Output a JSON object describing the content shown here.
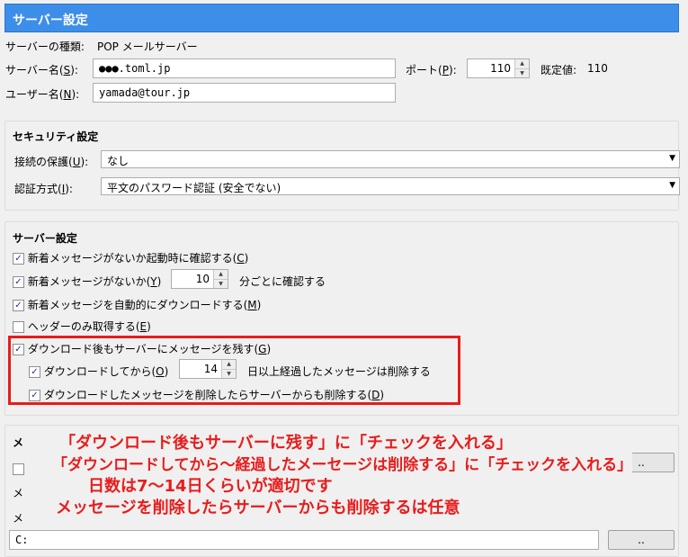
{
  "header": {
    "title": "サーバー設定"
  },
  "server": {
    "type_label": "サーバーの種類:",
    "type_value": "POP メールサーバー",
    "name_label_pre": "サーバー名(",
    "name_label_key": "S",
    "name_label_post": "):",
    "name_value": "●●●.toml.jp",
    "port_label_pre": "ポート(",
    "port_label_key": "P",
    "port_label_post": "):",
    "port_value": "110",
    "default_label": "既定値:",
    "default_value": "110",
    "user_label_pre": "ユーザー名(",
    "user_label_key": "N",
    "user_label_post": "):",
    "user_value": "yamada@tour.jp"
  },
  "security": {
    "title": "セキュリティ設定",
    "conn_label_pre": "接続の保護(",
    "conn_label_key": "U",
    "conn_label_post": "):",
    "conn_value": "なし",
    "auth_label_pre": "認証方式(",
    "auth_label_key": "I",
    "auth_label_post": "):",
    "auth_value": "平文のパスワード認証 (安全でない)"
  },
  "settings": {
    "title": "サーバー設定",
    "items": [
      {
        "pre": "新着メッセージがないか起動時に確認する(",
        "key": "C",
        "post": ")",
        "checked": true
      },
      {
        "pre": "新着メッセージがないか(",
        "key": "Y",
        "post": ")",
        "checked": true,
        "spin": "10",
        "suffix": "分ごとに確認する"
      },
      {
        "pre": "新着メッセージを自動的にダウンロードする(",
        "key": "M",
        "post": ")",
        "checked": true
      },
      {
        "pre": "ヘッダーのみ取得する(",
        "key": "E",
        "post": ")",
        "checked": false
      },
      {
        "pre": "ダウンロード後もサーバーにメッセージを残す(",
        "key": "G",
        "post": ")",
        "checked": true
      },
      {
        "pre": "ダウンロードしてから(",
        "key": "O",
        "post": ")",
        "checked": true,
        "spin": "14",
        "suffix": "日以上経過したメッセージは削除する"
      },
      {
        "pre": "ダウンロードしたメッセージを削除したらサーバーからも削除する(",
        "key": "D",
        "post": ")",
        "checked": true
      }
    ]
  },
  "annotation": {
    "lines": [
      "「ダウンロード後もサーバーに残す」に「チェックを入れる」",
      "「ダウンロードしてから〜経過したメーセージは削除する」に「チェックを入れる」",
      "日数は7〜14日くらいが適切です",
      "メッセージを削除したらサーバーからも削除するは任意"
    ],
    "color": "#e81c1c"
  },
  "storage": {
    "title_partial": "メ",
    "row1_partial": "メ",
    "row2_partial": "メ",
    "path_partial": "C:",
    "browse_label": "..",
    "browse2_label": ".."
  },
  "icons": {
    "checkbox": "check-icon",
    "spin_up": "▲",
    "spin_down": "▼",
    "dropdown": "▼",
    "check_mark": "✓"
  }
}
